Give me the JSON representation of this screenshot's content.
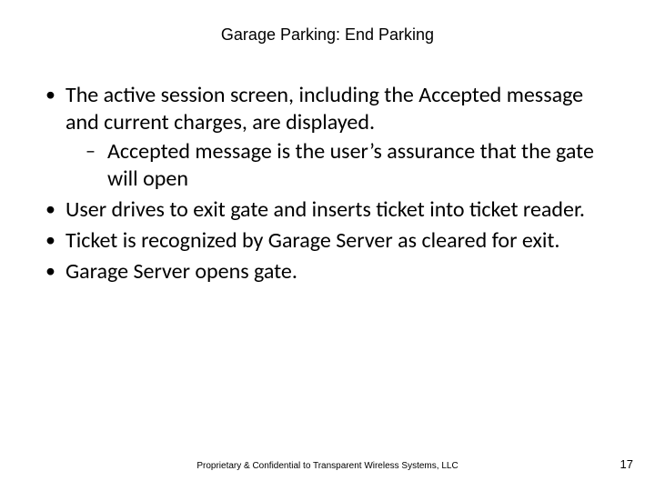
{
  "title": "Garage Parking: End Parking",
  "bullets": [
    {
      "text": "The active session screen, including the Accepted message and current charges, are displayed.",
      "sub": [
        "Accepted message is the user’s assurance that the gate will open"
      ]
    },
    {
      "text": "User drives to exit gate and inserts ticket into ticket reader."
    },
    {
      "text": " Ticket is recognized by Garage Server as cleared for exit."
    },
    {
      "text": "Garage Server opens gate."
    }
  ],
  "footer": "Proprietary & Confidential to Transparent Wireless Systems, LLC",
  "page_number": "17"
}
